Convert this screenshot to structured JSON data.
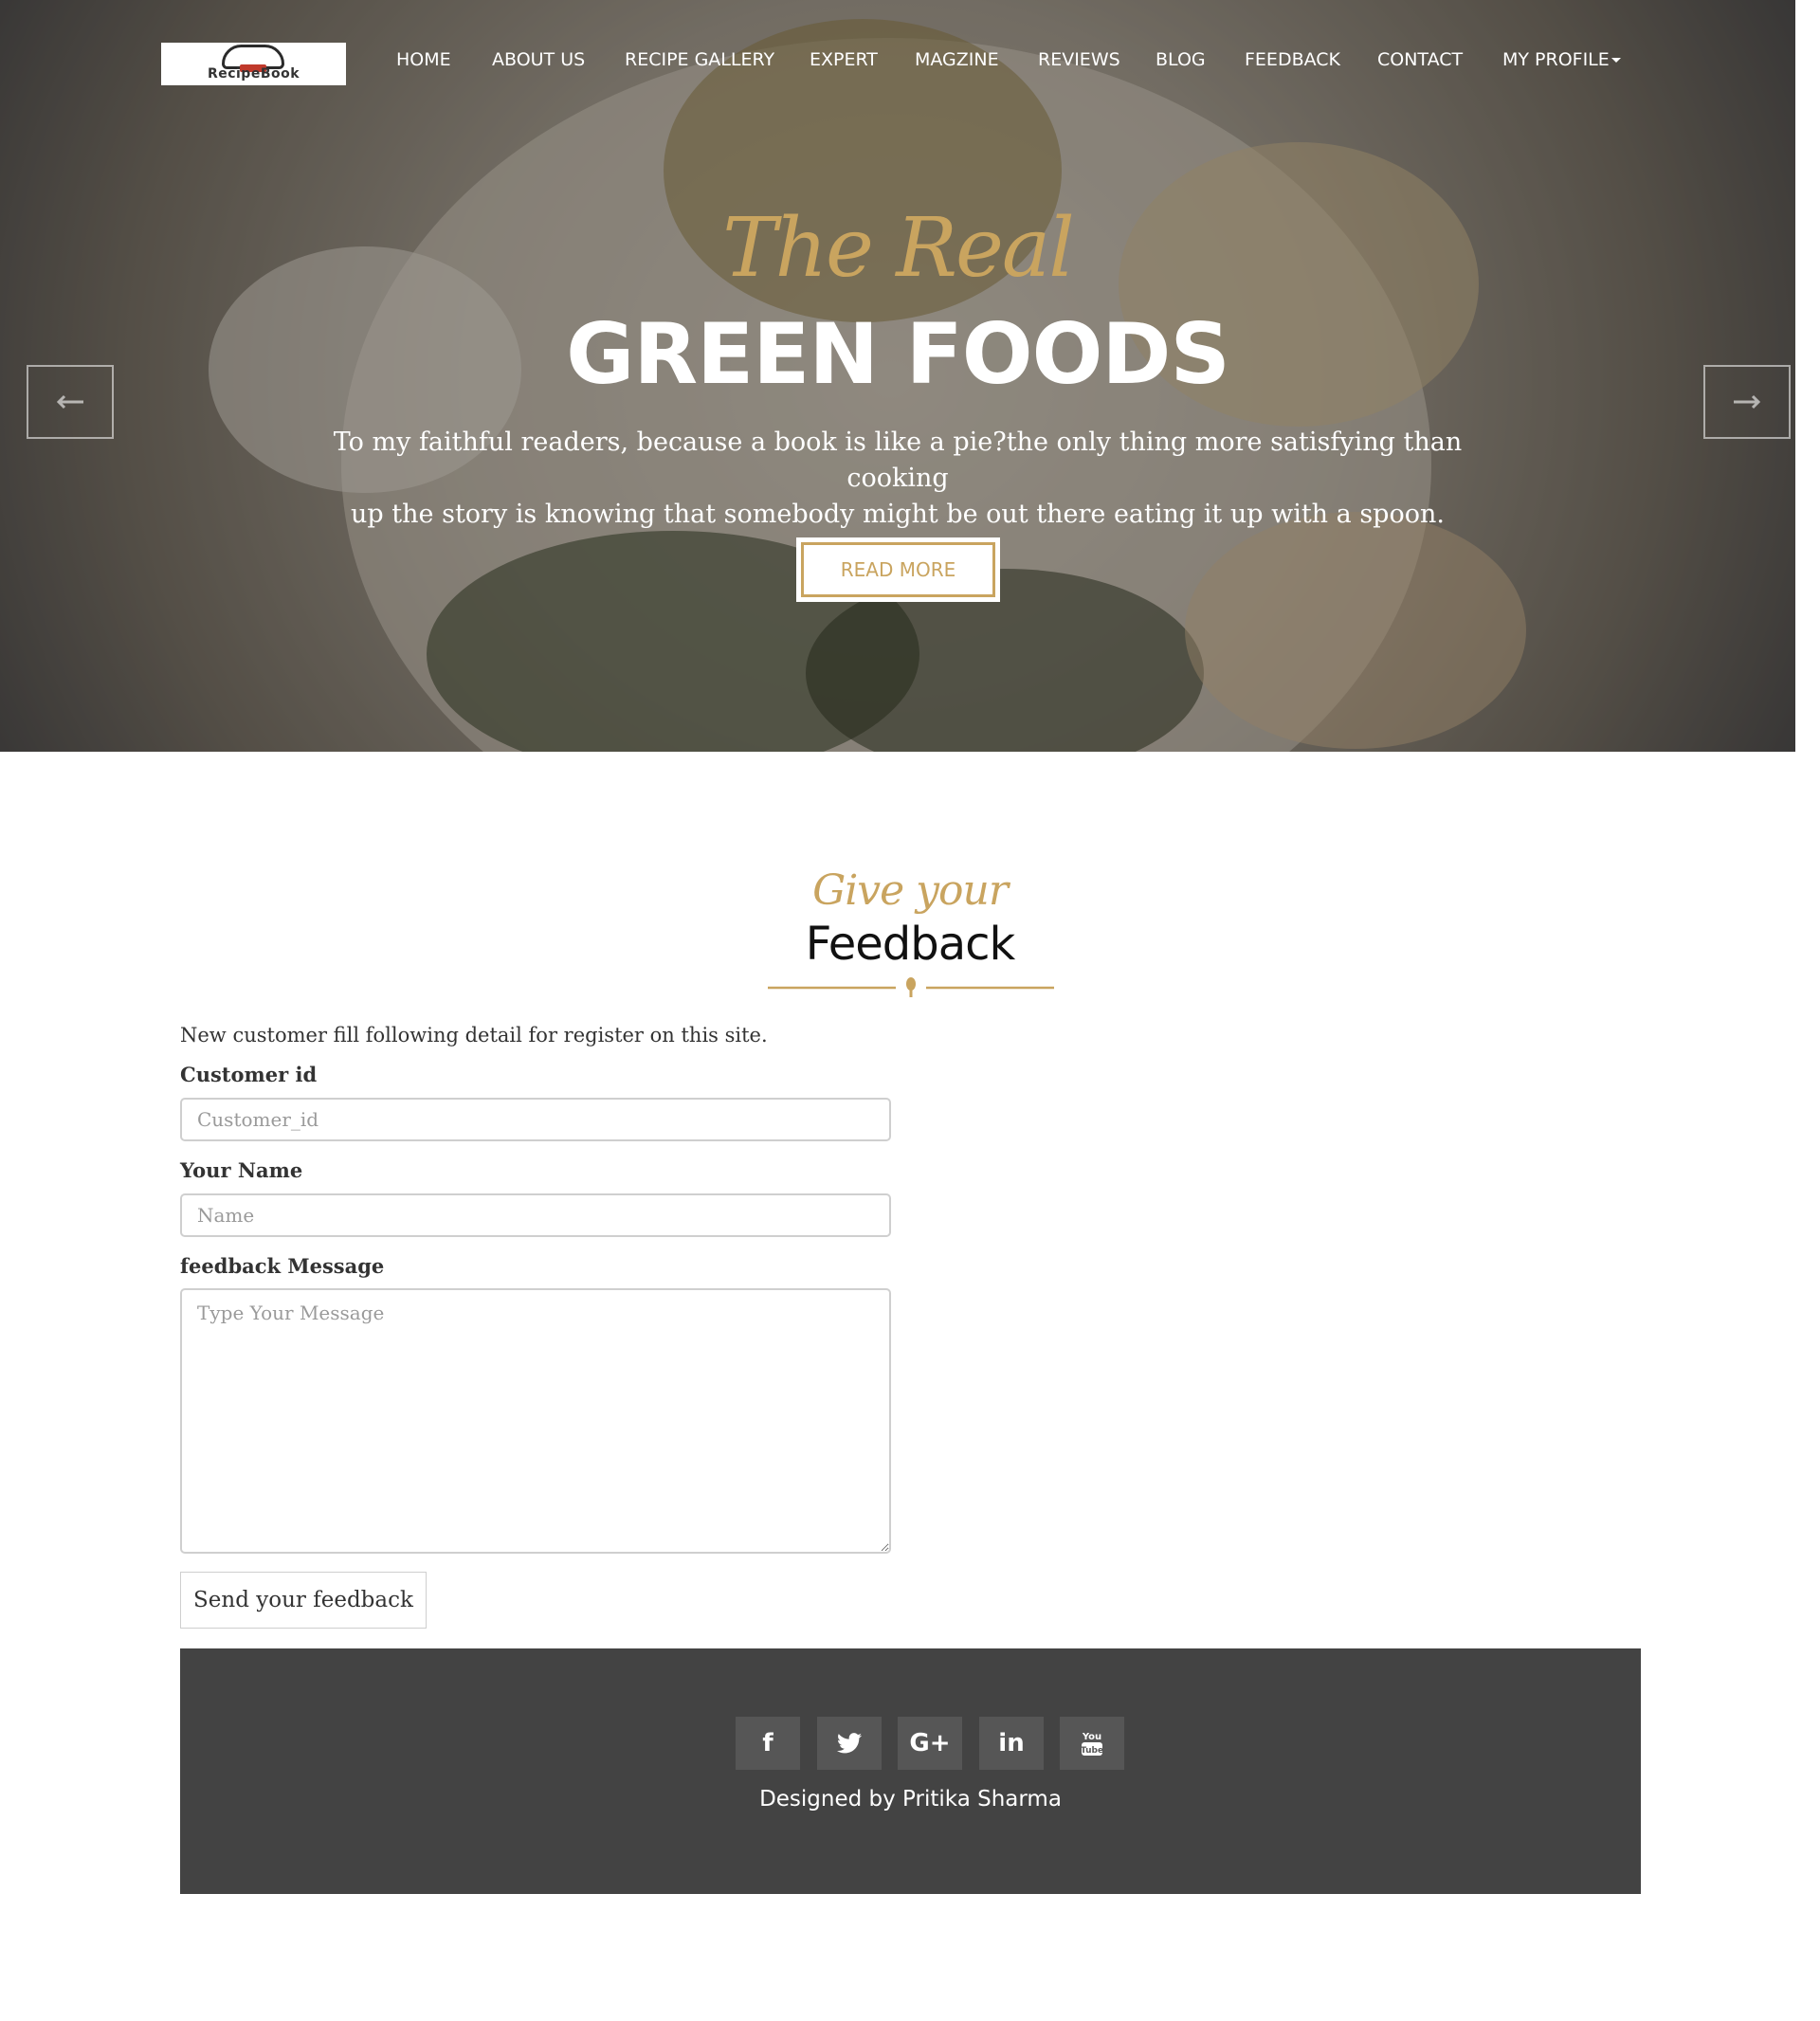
{
  "nav": {
    "logo_text": "RecipeBook",
    "items": [
      {
        "label": "HOME"
      },
      {
        "label": "ABOUT US"
      },
      {
        "label": "RECIPE GALLERY"
      },
      {
        "label": "EXPERT"
      },
      {
        "label": "MAGZINE"
      },
      {
        "label": "REVIEWS"
      },
      {
        "label": "BLOG"
      },
      {
        "label": "FEEDBACK"
      },
      {
        "label": "CONTACT"
      },
      {
        "label": "MY PROFILE"
      }
    ]
  },
  "hero": {
    "script": "The Real",
    "title": "GREEN FOODS",
    "text_line1": "To my faithful readers, because a book is like a pie?the only thing more satisfying than cooking",
    "text_line2": "up the story is knowing that somebody might be out there eating it up with a spoon.",
    "button": "READ MORE",
    "prev_icon": "arrow-left-icon",
    "next_icon": "arrow-right-icon"
  },
  "section": {
    "script": "Give your",
    "title": "Feedback"
  },
  "form": {
    "intro": "New customer fill following detail for register on this site.",
    "customer_id_label": "Customer id",
    "customer_id_placeholder": "Customer_id",
    "name_label": "Your Name",
    "name_placeholder": "Name",
    "message_label": "feedback Message",
    "message_placeholder": "Type Your Message",
    "submit": "Send your feedback"
  },
  "footer": {
    "social": [
      {
        "icon": "facebook-icon",
        "glyph": "f"
      },
      {
        "icon": "twitter-icon",
        "glyph": ""
      },
      {
        "icon": "google-plus-icon",
        "glyph": "G+"
      },
      {
        "icon": "linkedin-icon",
        "glyph": "in"
      },
      {
        "icon": "youtube-icon",
        "glyph": ""
      }
    ],
    "credit": "Designed by Pritika Sharma"
  },
  "colors": {
    "accent": "#c9a45f",
    "footer_bg": "#434343",
    "social_bg": "#565656"
  }
}
